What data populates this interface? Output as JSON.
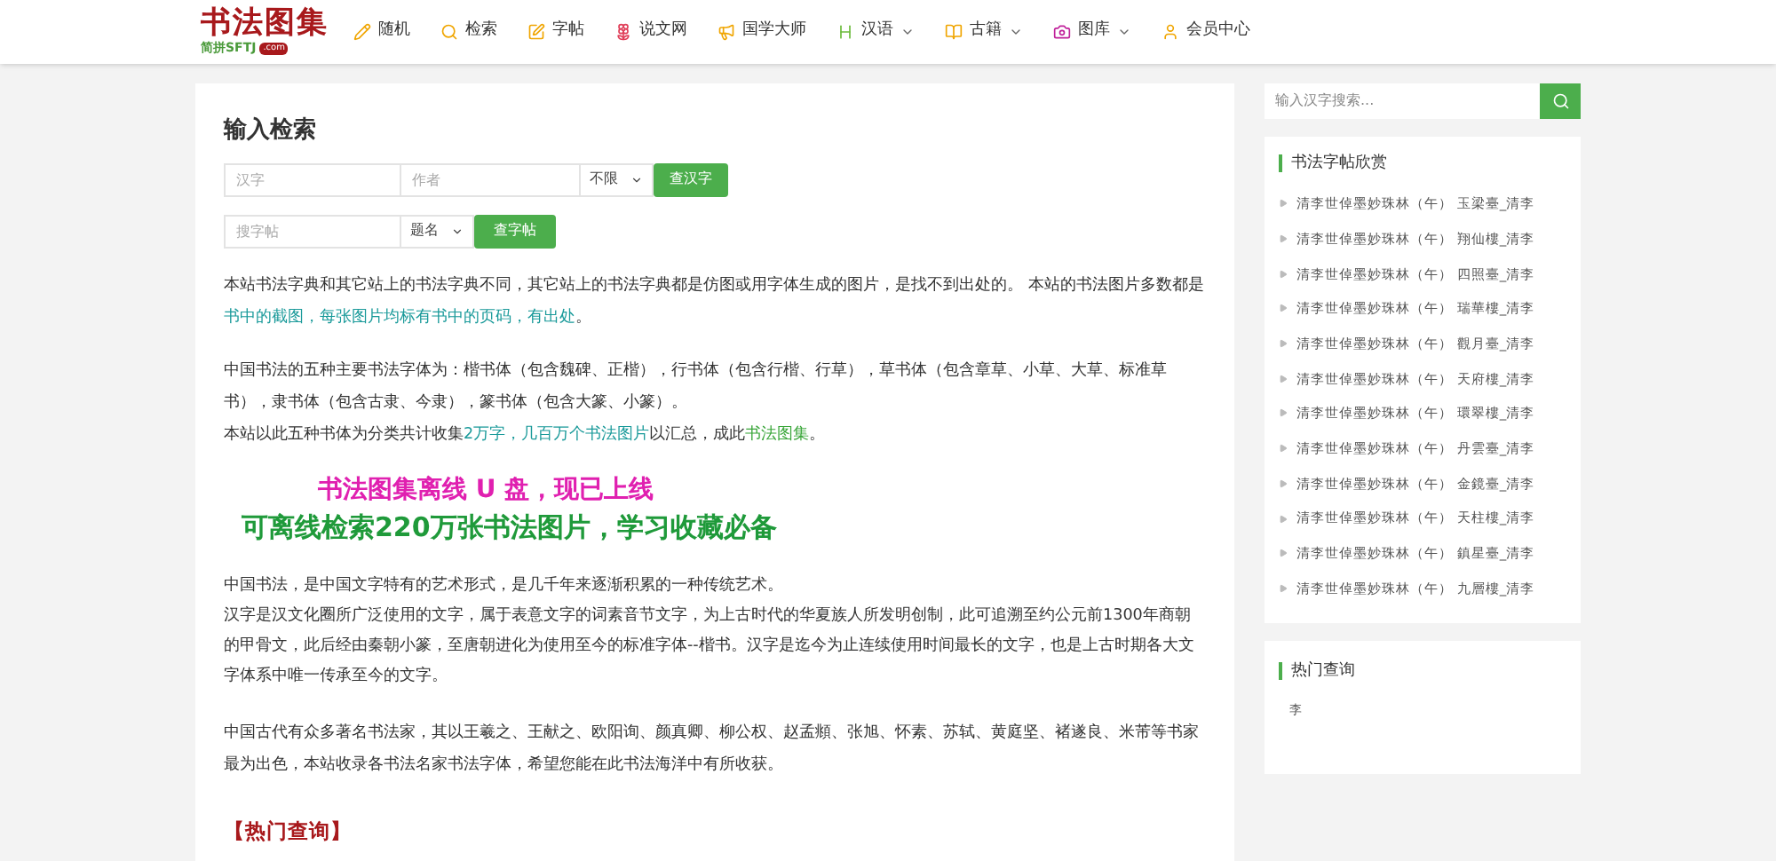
{
  "logo": {
    "title": "书法图集",
    "subtitle": "简拼SFTJ",
    "badge": ".com"
  },
  "nav": [
    {
      "label": "随机",
      "dropdown": false
    },
    {
      "label": "检索",
      "dropdown": false
    },
    {
      "label": "字帖",
      "dropdown": false
    },
    {
      "label": "说文网",
      "dropdown": false
    },
    {
      "label": "国学大师",
      "dropdown": false
    },
    {
      "label": "汉语",
      "dropdown": true
    },
    {
      "label": "古籍",
      "dropdown": true
    },
    {
      "label": "图库",
      "dropdown": true
    },
    {
      "label": "会员中心",
      "dropdown": false
    }
  ],
  "search": {
    "title": "输入检索",
    "char_field": {
      "placeholder": "汉字"
    },
    "author_field": {
      "placeholder": "作者"
    },
    "style_select": {
      "value": "不限"
    },
    "char_button": "查汉字",
    "copybook_field": {
      "placeholder": "搜字帖"
    },
    "copybook_select": {
      "value": "题名"
    },
    "copybook_button": "查字帖"
  },
  "paragraphs": [
    {
      "parts": [
        {
          "text": "本站书法字典和其它站上的书法字典不同，其它站上的书法字典都是仿图或用字体生成的图片，是找不到出处的。 本站的书法图片多数都是"
        },
        {
          "text": "书中的截图，每张图片均标有书中的页码，有出处",
          "link": true,
          "color": "#1a9a9a"
        },
        {
          "text": "。"
        }
      ]
    },
    {
      "parts": [
        {
          "text": "中国书法的五种主要书法字体为：楷书体（包含魏碑、正楷），行书体（包含行楷、行草），草书体（包含章草、小草、大草、标准草书），隶书体（包含古隶、今隶），篆书体（包含大篆、小篆）。"
        }
      ]
    },
    {
      "parts": [
        {
          "text": "本站以此五种书体为分类共计收集"
        },
        {
          "text": "2万字，几百万个书法图片",
          "link": true,
          "color": "#1a9a9a"
        },
        {
          "text": "以汇总，成此"
        },
        {
          "text": "书法图集",
          "link": true,
          "color": "#3aa63a"
        },
        {
          "text": "。"
        }
      ]
    }
  ],
  "promo": {
    "line1": "书法图集离线 U 盘，现已上线",
    "line2": "可离线检索220万张书法图片，学习收藏必备"
  },
  "intro": [
    "中国书法，是中国文字特有的艺术形式，是几千年来逐渐积累的一种传统艺术。",
    "汉字是汉文化圈所广泛使用的文字，属于表意文字的词素音节文字，为上古时代的华夏族人所发明创制，此可追溯至约公元前1300年商朝的甲骨文，此后经由秦朝小篆，至唐朝进化为使用至今的标准字体--楷书。汉字是迄今为止连续使用时间最长的文字，也是上古时期各大文字体系中唯一传承至今的文字。"
  ],
  "calligraphers": "中国古代有众多著名书法家，其以王羲之、王献之、欧阳询、颜真卿、柳公权、赵孟頫、张旭、怀素、苏轼、黄庭坚、褚遂良、米芾等书家最为出色，本站收录各书法名家书法字体，希望您能在此书法海洋中有所收获。",
  "hot_heading": "【热门查询】",
  "sidebar": {
    "search": {
      "placeholder": "输入汉字搜索..."
    },
    "copybooks": {
      "title": "书法字帖欣赏",
      "items": [
        "清李世倬墨妙珠林（午） 玉梁臺_清李",
        "清李世倬墨妙珠林（午） 翔仙樓_清李",
        "清李世倬墨妙珠林（午） 四照臺_清李",
        "清李世倬墨妙珠林（午） 瑞華樓_清李",
        "清李世倬墨妙珠林（午） 觀月臺_清李",
        "清李世倬墨妙珠林（午） 天府樓_清李",
        "清李世倬墨妙珠林（午） 環翠樓_清李",
        "清李世倬墨妙珠林（午） 丹雲臺_清李",
        "清李世倬墨妙珠林（午） 金鏡臺_清李",
        "清李世倬墨妙珠林（午） 天柱樓_清李",
        "清李世倬墨妙珠林（午） 鎮星臺_清李",
        "清李世倬墨妙珠林（午） 九層樓_清李"
      ]
    },
    "hot": {
      "title": "热门查询",
      "items": [
        "李"
      ]
    }
  }
}
